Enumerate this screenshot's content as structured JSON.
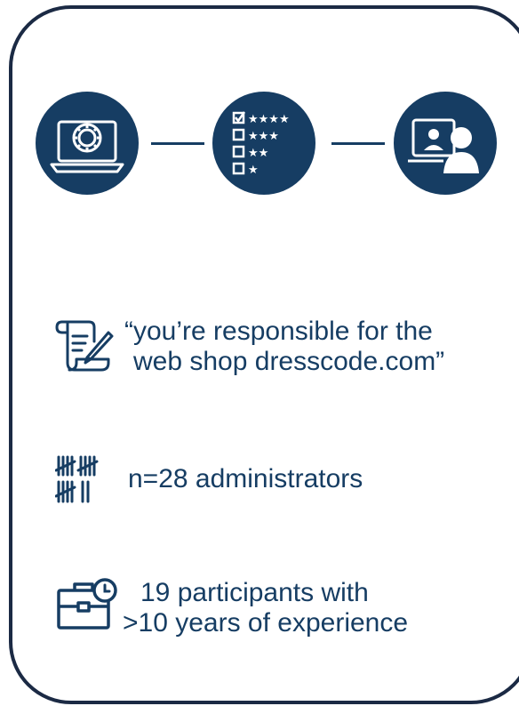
{
  "flow": {
    "steps": [
      {
        "icon": "laptop-gear-icon"
      },
      {
        "icon": "rating-checklist-icon"
      },
      {
        "icon": "video-call-icon"
      }
    ]
  },
  "items": [
    {
      "icon": "scroll-quill-icon",
      "line1": "“you’re responsible for the",
      "line2": "web shop dresscode.com”"
    },
    {
      "icon": "tally-marks-icon",
      "line1": "n=28 administrators"
    },
    {
      "icon": "briefcase-clock-icon",
      "line1": "19 participants with",
      "line2": ">10 years of experience"
    }
  ],
  "colors": {
    "primary": "#163d63",
    "border": "#1b2a44",
    "background": "#ffffff"
  }
}
